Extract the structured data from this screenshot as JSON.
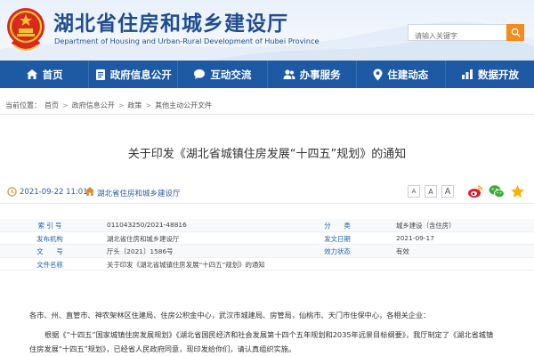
{
  "header": {
    "title": "湖北省住房和城乡建设厅",
    "subtitle": "Department of Housing and Urban-Rural Development of Hubei Province",
    "search_placeholder": "请输入关键字",
    "emblem_icon": "national-emblem-icon",
    "search_icon": "search-icon"
  },
  "nav": {
    "items": [
      {
        "label": "首页",
        "icon": "home-icon"
      },
      {
        "label": "政府信息公开",
        "icon": "document-icon"
      },
      {
        "label": "互动交流",
        "icon": "chat-icon"
      },
      {
        "label": "办事服务",
        "icon": "people-icon"
      },
      {
        "label": "住建动态",
        "icon": "location-icon"
      },
      {
        "label": "数据开放",
        "icon": "chart-icon"
      }
    ],
    "color": "#1d5aa3"
  },
  "breadcrumb": {
    "prefix": "当前位置：",
    "items": [
      "首页",
      "政府信息公开",
      "政策",
      "其他主动公开文件"
    ],
    "separator": ">"
  },
  "article": {
    "title": "关于印发《湖北省城镇住房发展“十四五”规划》的通知",
    "date": "2021-09-22 11:01",
    "source": "湖北省住房和城乡建设厅",
    "font_sizes": [
      "A",
      "A",
      "A"
    ],
    "share_icons": [
      "weibo-icon",
      "wechat-icon",
      "favorite-star-icon"
    ]
  },
  "info_table": {
    "rows": [
      {
        "label1": "索 引 号",
        "value1": "011043250/2021-48816",
        "label2": "分　　类",
        "value2": "城乡建设（含住房）"
      },
      {
        "label1": "发布机构",
        "value1": "湖北省住房和城乡建设厅",
        "label2": "发文日期",
        "value2": "2021-09-17"
      },
      {
        "label1": "文　　号",
        "value1": "厅头〔2021〕1586号",
        "label2": "效力状态",
        "value2": "有效"
      },
      {
        "label1": "文件名称",
        "value1": "关于印发《湖北省城镇住房发展“十四五”规划》的通知",
        "label2": "",
        "value2": ""
      }
    ]
  },
  "body": {
    "salutation": "各市、州、直管市、神农架林区住建局、住房公积金中心，武汉市城建局、房管局，仙桃市、天门市住保中心，各相关企业：",
    "paragraph1_line1": "根据《“十四五”国家城镇住房发展规划》《湖北省国民经济和社会发展第十四个五年规划和2035年远景目标纲要》，我厅制定了《湖北省城镇",
    "paragraph1_line2": "住房发展“十四五”规划》，已经省人民政府同意，现印发给你们，请认真组织实施。"
  },
  "colors": {
    "brand_blue": "#1d5aa3",
    "link_blue": "#2160ad",
    "search_button": "#f18d1c"
  }
}
